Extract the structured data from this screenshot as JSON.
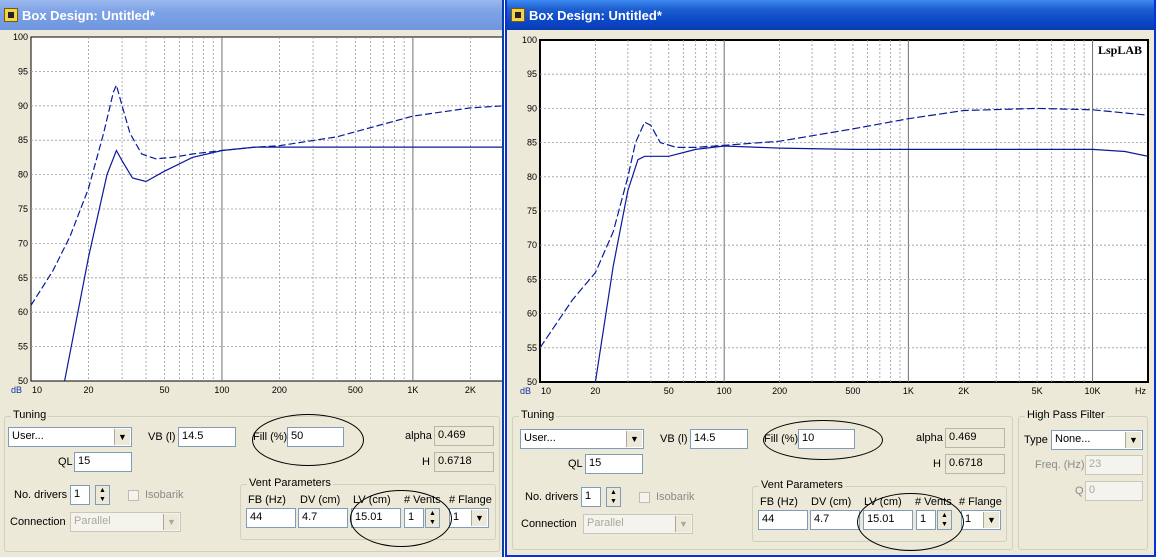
{
  "left_window": {
    "title": "Box Design: Untitled*",
    "chart_data": {
      "type": "line",
      "ylabel": "dB",
      "ylim": [
        50,
        100
      ],
      "xscale": "log",
      "xlim": [
        10,
        3000
      ],
      "y_ticks": [
        "100",
        "95",
        "90",
        "85",
        "80",
        "75",
        "70",
        "65",
        "60",
        "55",
        "50"
      ],
      "x_ticks": [
        "10",
        "20",
        "50",
        "100",
        "200",
        "500",
        "1K",
        "2K"
      ],
      "series": [
        {
          "style": "solid",
          "x": [
            15,
            20,
            25,
            28,
            30,
            34,
            40,
            50,
            70,
            100,
            150,
            200,
            500,
            1000,
            3000
          ],
          "y": [
            50,
            68,
            80,
            83.5,
            82,
            79.5,
            79,
            80.5,
            82.5,
            83.5,
            84,
            84,
            84,
            84,
            84
          ]
        },
        {
          "style": "dashed",
          "x": [
            10,
            13,
            16,
            20,
            24,
            27,
            28,
            30,
            33,
            38,
            45,
            55,
            70,
            100,
            150,
            200,
            400,
            1000,
            2000,
            3000
          ],
          "y": [
            61,
            66,
            71,
            78,
            86,
            92,
            93,
            90,
            86,
            83,
            82.3,
            82.5,
            83,
            83.5,
            84,
            84.2,
            85.5,
            88.5,
            89.7,
            90
          ]
        }
      ]
    },
    "tuning_label": "Tuning",
    "tuning_mode": "User...",
    "vb_label": "VB (l)",
    "vb_value": "14.5",
    "fill_label": "Fill (%)",
    "fill_value": "50",
    "alpha_label": "alpha",
    "alpha_value": "0.469",
    "ql_label": "QL",
    "ql_value": "15",
    "h_label": "H",
    "h_value": "0.6718",
    "drivers_label": "No. drivers",
    "drivers_value": "1",
    "isobarik_label": "Isobarik",
    "connection_label": "Connection",
    "connection_value": "Parallel",
    "vent": {
      "title": "Vent Parameters",
      "fb_label": "FB (Hz)",
      "fb_value": "44",
      "dv_label": "DV (cm)",
      "dv_value": "4.7",
      "lv_label": "LV (cm)",
      "lv_value": "15.01",
      "vents_label": "# Vents",
      "vents_value": "1",
      "flange_label": "# Flange",
      "flange_value": "1"
    }
  },
  "right_window": {
    "title": "Box Design: Untitled*",
    "watermark": "LspLAB",
    "chart_data": {
      "type": "line",
      "ylabel": "dB",
      "xlabel": "Hz",
      "ylim": [
        50,
        100
      ],
      "xscale": "log",
      "xlim": [
        10,
        20000
      ],
      "y_ticks": [
        "100",
        "95",
        "90",
        "85",
        "80",
        "75",
        "70",
        "65",
        "60",
        "55",
        "50"
      ],
      "x_ticks": [
        "10",
        "20",
        "50",
        "100",
        "200",
        "500",
        "1K",
        "2K",
        "5K",
        "10K"
      ],
      "series": [
        {
          "style": "solid",
          "x": [
            20,
            25,
            30,
            34,
            37,
            40,
            50,
            70,
            100,
            200,
            500,
            1000,
            5000,
            10000,
            15000,
            20000
          ],
          "y": [
            50,
            67,
            78,
            82.5,
            83,
            83,
            83,
            84,
            84.5,
            84.2,
            84,
            84,
            84,
            84,
            83.7,
            83
          ]
        },
        {
          "style": "dashed",
          "x": [
            10,
            15,
            20,
            25,
            30,
            33,
            37,
            40,
            45,
            55,
            70,
            100,
            200,
            500,
            1000,
            2000,
            5000,
            10000,
            20000
          ],
          "y": [
            55,
            62,
            66,
            72,
            80,
            85,
            88,
            87.5,
            85,
            84.3,
            84.3,
            84.6,
            85.2,
            87,
            88.5,
            89.7,
            90,
            89.8,
            89
          ]
        }
      ]
    },
    "tuning_label": "Tuning",
    "tuning_mode": "User...",
    "vb_label": "VB (l)",
    "vb_value": "14.5",
    "fill_label": "Fill (%)",
    "fill_value": "10",
    "alpha_label": "alpha",
    "alpha_value": "0.469",
    "ql_label": "QL",
    "ql_value": "15",
    "h_label": "H",
    "h_value": "0.6718",
    "drivers_label": "No. drivers",
    "drivers_value": "1",
    "isobarik_label": "Isobarik",
    "connection_label": "Connection",
    "connection_value": "Parallel",
    "vent": {
      "title": "Vent Parameters",
      "fb_label": "FB (Hz)",
      "fb_value": "44",
      "dv_label": "DV (cm)",
      "dv_value": "4.7",
      "lv_label": "LV (cm)",
      "lv_value": "15.01",
      "vents_label": "# Vents",
      "vents_value": "1",
      "flange_label": "# Flange",
      "flange_value": "1"
    },
    "hpf": {
      "title": "High Pass Filter",
      "type_label": "Type",
      "type_value": "None...",
      "freq_label": "Freq. (Hz)",
      "freq_value": "23",
      "q_label": "Q",
      "q_value": "0"
    }
  }
}
